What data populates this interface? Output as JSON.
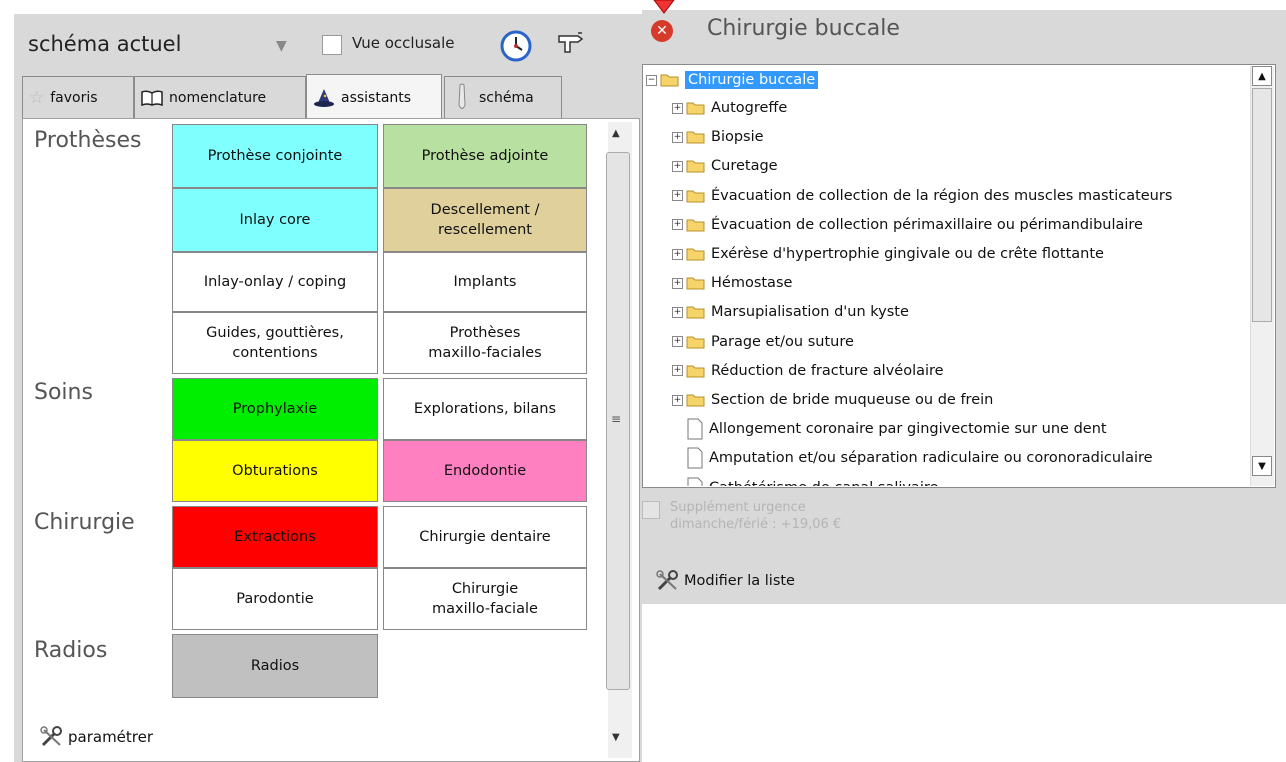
{
  "toolbar": {
    "schema_value": "schéma actuel",
    "occlusal_label": "Vue occlusale",
    "occlusal_checked": false
  },
  "tabs": [
    {
      "label": "favoris",
      "icon": "star-icon",
      "active": false
    },
    {
      "label": "nomenclature",
      "icon": "book-icon",
      "active": false
    },
    {
      "label": "assistants",
      "icon": "wizard-hat-icon",
      "active": true
    },
    {
      "label": "schéma",
      "icon": "tooth-icon",
      "active": false
    }
  ],
  "assistants": {
    "sections": [
      "Prothèses",
      "Soins",
      "Chirurgie",
      "Radios"
    ],
    "tiles": [
      {
        "label": "Prothèse conjointe",
        "color": "#80ffff"
      },
      {
        "label": "Prothèse adjointe",
        "color": "#b8e0a0"
      },
      {
        "label": "Inlay core",
        "color": "#80ffff"
      },
      {
        "label": "Descellement /\nrescellement",
        "color": "#e0d09c"
      },
      {
        "label": "Inlay-onlay / coping",
        "color": "#ffffff"
      },
      {
        "label": "Implants",
        "color": "#ffffff"
      },
      {
        "label": "Guides, gouttières,\ncontentions",
        "color": "#ffffff"
      },
      {
        "label": "Prothèses\nmaxillo-faciales",
        "color": "#ffffff"
      },
      {
        "label": "Prophylaxie",
        "color": "#00ee00"
      },
      {
        "label": "Explorations, bilans",
        "color": "#ffffff"
      },
      {
        "label": "Obturations",
        "color": "#ffff00"
      },
      {
        "label": "Endodontie",
        "color": "#ff80c0"
      },
      {
        "label": "Extractions",
        "color": "#ff0000"
      },
      {
        "label": "Chirurgie dentaire",
        "color": "#ffffff"
      },
      {
        "label": "Parodontie",
        "color": "#ffffff"
      },
      {
        "label": "Chirurgie\nmaxillo-faciale",
        "color": "#ffffff"
      },
      {
        "label": "Radios",
        "color": "#c0c0c0"
      }
    ],
    "settings_label": "paramétrer"
  },
  "right_panel": {
    "title": "Chirurgie buccale",
    "tree": {
      "root": "Chirurgie buccale",
      "folders": [
        "Autogreffe",
        "Biopsie",
        "Curetage",
        "Évacuation de collection de la région des muscles masticateurs",
        "Évacuation de collection périmaxillaire ou périmandibulaire",
        "Exérèse d'hypertrophie gingivale ou de crête flottante",
        "Hémostase",
        "Marsupialisation d'un kyste",
        "Parage et/ou suture",
        "Réduction de fracture alvéolaire",
        "Section de bride muqueuse ou de frein"
      ],
      "documents": [
        "Allongement coronaire par gingivectomie sur une dent",
        "Amputation et/ou séparation radiculaire ou coronoradiculaire",
        "Cathétérisme de canal salivaire"
      ]
    },
    "urgence_label": "Supplément urgence",
    "urgence_value": "dimanche/férié : +19,06 €",
    "urgence_checked": false,
    "modify_label": "Modifier la liste"
  }
}
